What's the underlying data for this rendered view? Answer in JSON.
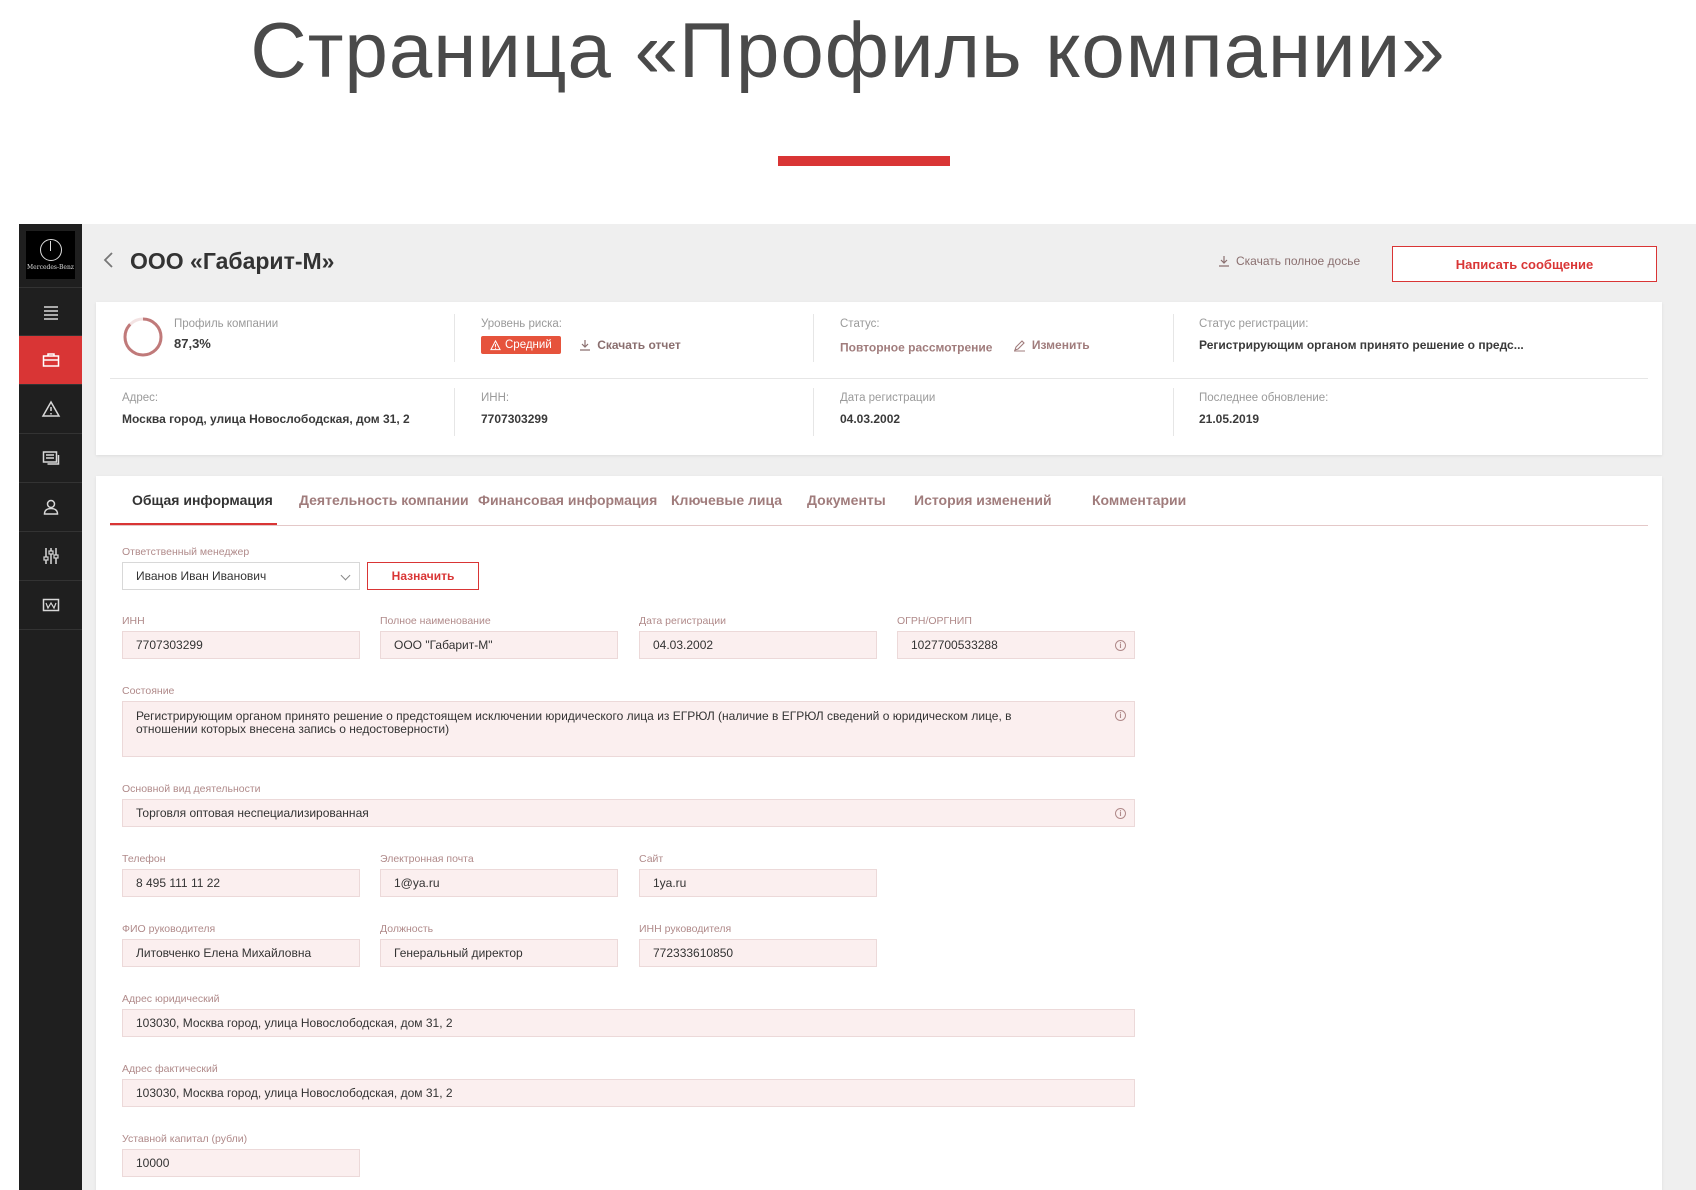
{
  "hero": {
    "title": "Страница «Профиль компании»"
  },
  "brand": {
    "logo_text": "Mercedes-Benz",
    "accent": "#d93535"
  },
  "sidebar": {
    "items": [
      {
        "icon": "menu-icon"
      },
      {
        "icon": "briefcase-icon",
        "active": true
      },
      {
        "icon": "warning-icon"
      },
      {
        "icon": "messages-icon"
      },
      {
        "icon": "user-icon"
      },
      {
        "icon": "sliders-icon"
      },
      {
        "icon": "wallet-icon"
      }
    ]
  },
  "header": {
    "company_name": "ООО «Габарит-М»",
    "download_dossier": "Скачать полное досье",
    "write_message": "Написать сообщение"
  },
  "summary": {
    "profile_label": "Профиль компании",
    "profile_value": "87,3%",
    "profile_progress": 0.873,
    "risk_label": "Уровень риска:",
    "risk_value": "Средний",
    "download_report": "Скачать отчет",
    "status_label": "Статус:",
    "status_value": "Повторное рассмотрение",
    "status_edit": "Изменить",
    "reg_status_label": "Статус регистрации:",
    "reg_status_value": "Регистрирующим органом принято решение о предс...",
    "address_label": "Адрес:",
    "address_value": "Москва город, улица Новослободская, дом 31, 2",
    "inn_label": "ИНН:",
    "inn_value": "7707303299",
    "reg_date_label": "Дата регистрации",
    "reg_date_value": "04.03.2002",
    "updated_label": "Последнее обновление:",
    "updated_value": "21.05.2019"
  },
  "tabs": [
    {
      "label": "Общая информация",
      "active": true
    },
    {
      "label": "Деятельность компании"
    },
    {
      "label": "Финансовая информация"
    },
    {
      "label": "Ключевые лица"
    },
    {
      "label": "Документы"
    },
    {
      "label": "История изменений"
    },
    {
      "label": "Комментарии"
    }
  ],
  "form": {
    "manager_label": "Ответственный менеджер",
    "manager_value": "Иванов Иван Иванович",
    "assign_button": "Назначить",
    "inn_label": "ИНН",
    "inn_value": "7707303299",
    "fullname_label": "Полное наименование",
    "fullname_value": "ООО \"Габарит-М\"",
    "regdate_label": "Дата регистрации",
    "regdate_value": "04.03.2002",
    "ogrn_label": "ОГРН/ОРГНИП",
    "ogrn_value": "1027700533288",
    "state_label": "Состояние",
    "state_value": "Регистрирующим органом принято решение о предстоящем исключении юридического лица из ЕГРЮЛ (наличие в ЕГРЮЛ сведений о юридическом лице, в отношении которых внесена запись о недостоверности)",
    "activity_label": "Основной вид деятельности",
    "activity_value": "Торговля оптовая неспециализированная",
    "phone_label": "Телефон",
    "phone_value": "8 495 111 11 22",
    "email_label": "Электронная почта",
    "email_value": "1@ya.ru",
    "site_label": "Сайт",
    "site_value": "1ya.ru",
    "head_label": "ФИО руководителя",
    "head_value": "Литовченко Елена Михайловна",
    "position_label": "Должность",
    "position_value": "Генеральный директор",
    "head_inn_label": "ИНН руководителя",
    "head_inn_value": "772333610850",
    "legal_addr_label": "Адрес юридический",
    "legal_addr_value": "103030, Москва город, улица Новослободская, дом 31, 2",
    "fact_addr_label": "Адрес фактический",
    "fact_addr_value": "103030, Москва город, улица Новослободская, дом 31, 2",
    "capital_label": "Уставной капитал (рубли)",
    "capital_value": "10000"
  }
}
